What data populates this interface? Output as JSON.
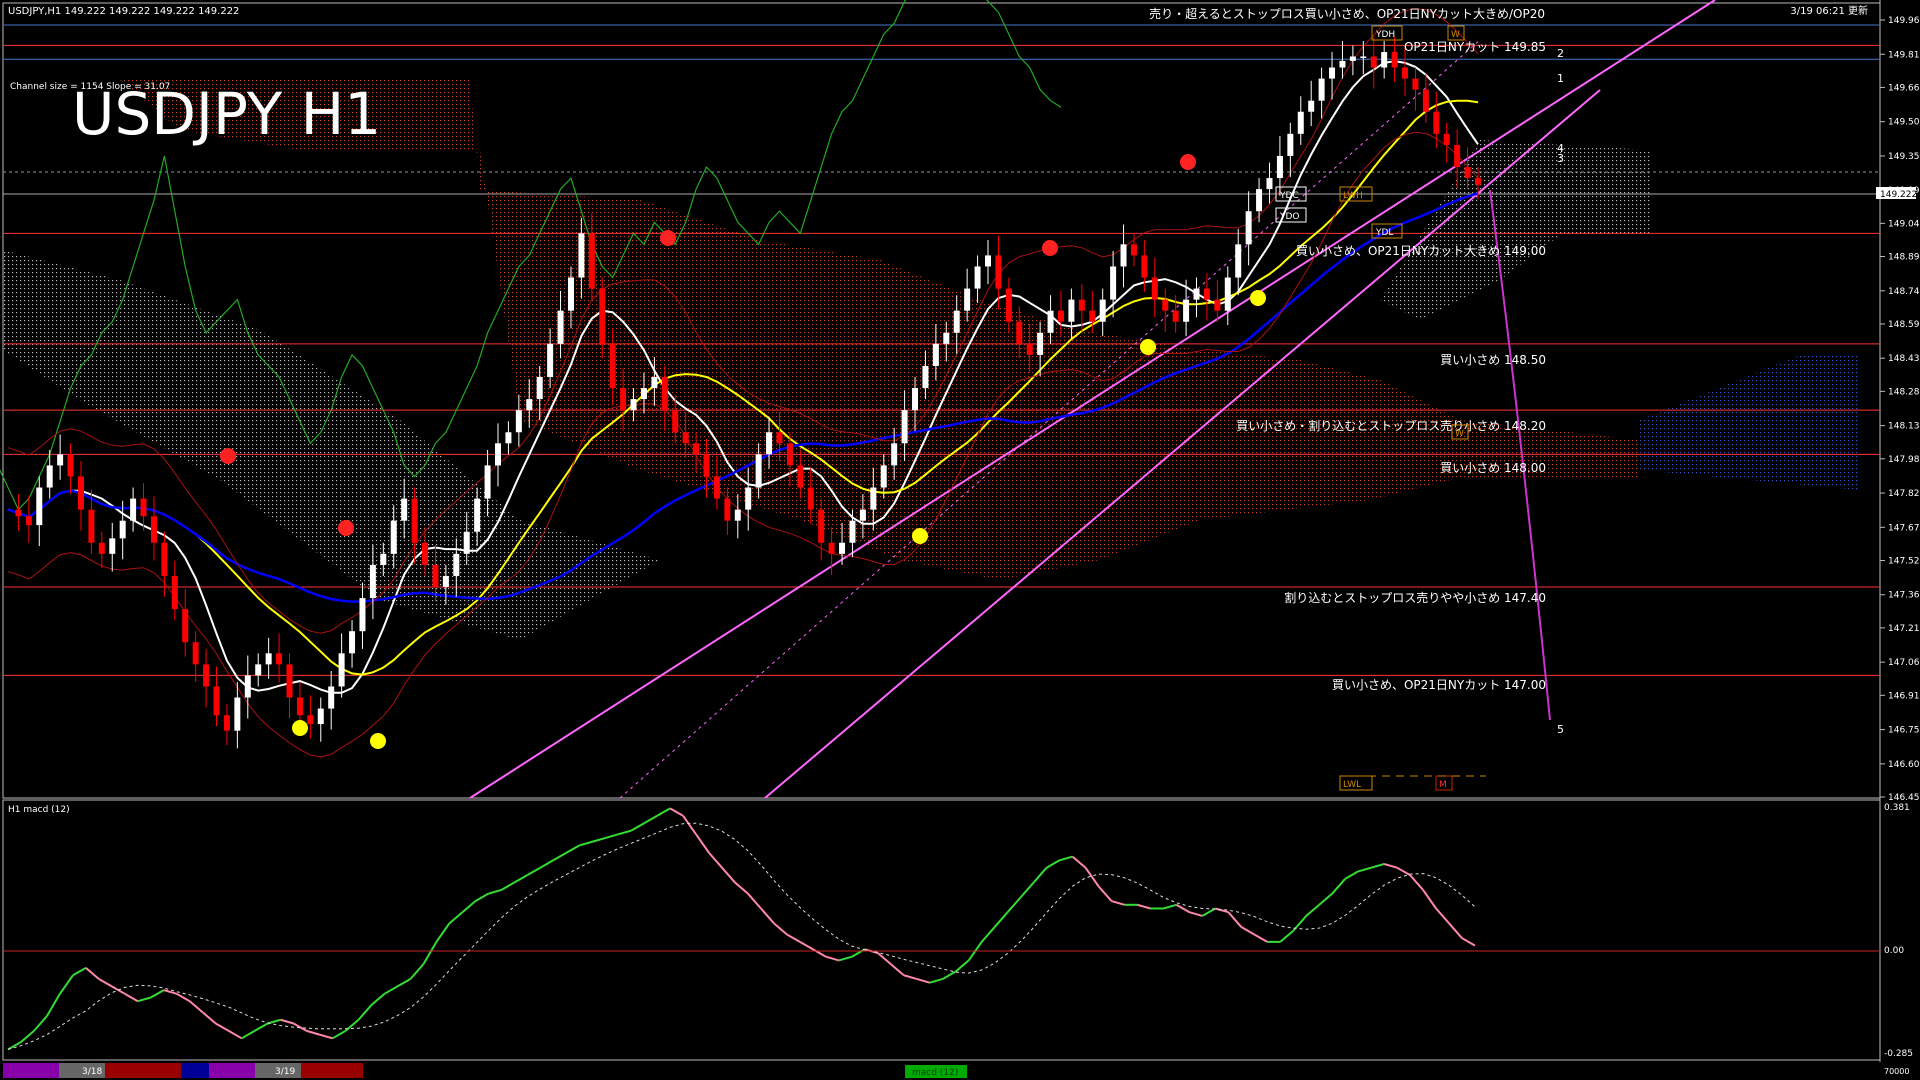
{
  "header": {
    "symbol_info": "USDJPY,H1  149.222 149.222 149.222 149.222",
    "timestamp": "3/19 06:21 更新",
    "channel_info": "Channel size = 1154 Slope = 31.07",
    "big_title": "USDJPY H1"
  },
  "main_price_axis": {
    "ticks": [
      "149.965",
      "149.810",
      "149.660",
      "149.505",
      "149.350",
      "149.195",
      "149.045",
      "148.895",
      "148.740",
      "148.590",
      "148.435",
      "148.285",
      "148.130",
      "147.980",
      "147.825",
      "147.670",
      "147.520",
      "147.365",
      "147.215",
      "147.060",
      "146.910",
      "146.755",
      "146.600",
      "146.450"
    ],
    "current_price": "149.222"
  },
  "annotations": {
    "top_note": "売り・超えるとストップロス買い小さめ、OP21日NYカット大きめ/OP20",
    "note_1": "OP21日NYカット 149.85",
    "note_2": "買い小さめ、OP21日NYカット大きめ 149.00",
    "note_3": "買い小さめ 148.50",
    "note_4": "買い小さめ・割り込むとストップロス売り小さめ 148.20",
    "note_5": "買い小さめ 148.00",
    "note_6": "割り込むとストップロス売りやや小さめ 147.40",
    "note_7": "買い小さめ、OP21日NYカット 147.00",
    "wave_1": "1",
    "wave_2": "2",
    "wave_3": "3",
    "wave_4": "4",
    "wave_5": "5",
    "ydh": "YDH",
    "ydc": "YDC",
    "ydo": "YDO",
    "ydl": "YDL",
    "lwh": "LWH",
    "lwl": "LWL",
    "w_top": "W",
    "w_mid": "W",
    "m_bot": "M"
  },
  "macd_panel": {
    "label": "H1  macd (12)",
    "ticks": [
      "0.381",
      "0.00",
      "-0.285"
    ],
    "bottom_right": "70000"
  },
  "time_bar": {
    "labels": [
      "3/18",
      "3/19"
    ],
    "center_label": "macd (12)"
  },
  "colors": {
    "bull": "#ffffff",
    "bear": "#ff0000",
    "ma_fast": "#ffffff",
    "ma_mid": "#ffff00",
    "ma_slow": "#0000ff",
    "channel": "#ff66ff",
    "chikou": "#22aa22",
    "macd_up": "#33dd33",
    "macd_down": "#ff88aa",
    "level_line": "#ff3333"
  },
  "chart_data": {
    "type": "candlestick",
    "symbol": "USDJPY",
    "timeframe": "H1",
    "ylim": [
      146.45,
      149.965
    ],
    "levels": [
      149.85,
      149.0,
      148.5,
      148.2,
      148.0,
      147.4,
      147.0
    ],
    "close_series": [
      147.75,
      147.72,
      147.68,
      147.85,
      147.95,
      148.0,
      147.9,
      147.75,
      147.6,
      147.55,
      147.62,
      147.7,
      147.8,
      147.72,
      147.6,
      147.45,
      147.3,
      147.15,
      147.05,
      146.95,
      146.82,
      146.75,
      146.9,
      147.0,
      147.05,
      147.1,
      147.05,
      146.9,
      146.82,
      146.78,
      146.85,
      146.95,
      147.1,
      147.2,
      147.35,
      147.5,
      147.55,
      147.7,
      147.8,
      147.6,
      147.5,
      147.4,
      147.45,
      147.55,
      147.65,
      147.8,
      147.95,
      148.05,
      148.1,
      148.2,
      148.25,
      148.35,
      148.5,
      148.65,
      148.8,
      149.0,
      148.75,
      148.5,
      148.3,
      148.2,
      148.25,
      148.3,
      148.35,
      148.2,
      148.1,
      148.05,
      148.0,
      147.9,
      147.8,
      147.7,
      147.75,
      147.85,
      148.0,
      148.1,
      148.05,
      147.95,
      147.85,
      147.75,
      147.6,
      147.55,
      147.6,
      147.7,
      147.75,
      147.85,
      147.95,
      148.05,
      148.2,
      148.3,
      148.4,
      148.5,
      148.55,
      148.65,
      148.75,
      148.85,
      148.9,
      148.75,
      148.6,
      148.5,
      148.45,
      148.55,
      148.65,
      148.6,
      148.7,
      148.65,
      148.6,
      148.7,
      148.85,
      148.95,
      148.9,
      148.8,
      148.7,
      148.65,
      148.6,
      148.7,
      148.75,
      148.7,
      148.65,
      148.8,
      148.95,
      149.1,
      149.2,
      149.25,
      149.35,
      149.45,
      149.55,
      149.6,
      149.7,
      149.75,
      149.78,
      149.8,
      149.8,
      149.75,
      149.82,
      149.75,
      149.7,
      149.65,
      149.55,
      149.45,
      149.4,
      149.3,
      149.25,
      149.22
    ],
    "macd_series": [
      -0.27,
      -0.25,
      -0.22,
      -0.18,
      -0.12,
      -0.07,
      -0.05,
      -0.08,
      -0.1,
      -0.12,
      -0.14,
      -0.13,
      -0.11,
      -0.12,
      -0.14,
      -0.17,
      -0.2,
      -0.22,
      -0.24,
      -0.22,
      -0.2,
      -0.19,
      -0.2,
      -0.22,
      -0.23,
      -0.24,
      -0.22,
      -0.19,
      -0.15,
      -0.12,
      -0.1,
      -0.08,
      -0.04,
      0.02,
      0.07,
      0.1,
      0.13,
      0.15,
      0.16,
      0.18,
      0.2,
      0.22,
      0.24,
      0.26,
      0.28,
      0.29,
      0.3,
      0.31,
      0.32,
      0.34,
      0.36,
      0.38,
      0.36,
      0.31,
      0.26,
      0.22,
      0.18,
      0.15,
      0.11,
      0.07,
      0.04,
      0.02,
      0.0,
      -0.02,
      -0.03,
      -0.02,
      0.0,
      -0.01,
      -0.04,
      -0.07,
      -0.08,
      -0.09,
      -0.08,
      -0.06,
      -0.03,
      0.02,
      0.06,
      0.1,
      0.14,
      0.18,
      0.22,
      0.24,
      0.25,
      0.22,
      0.17,
      0.13,
      0.12,
      0.12,
      0.11,
      0.11,
      0.12,
      0.1,
      0.09,
      0.11,
      0.1,
      0.06,
      0.04,
      0.02,
      0.02,
      0.05,
      0.09,
      0.12,
      0.15,
      0.19,
      0.21,
      0.22,
      0.23,
      0.22,
      0.2,
      0.16,
      0.11,
      0.07,
      0.03,
      0.01
    ],
    "macd_ylim": [
      -0.285,
      0.381
    ]
  }
}
